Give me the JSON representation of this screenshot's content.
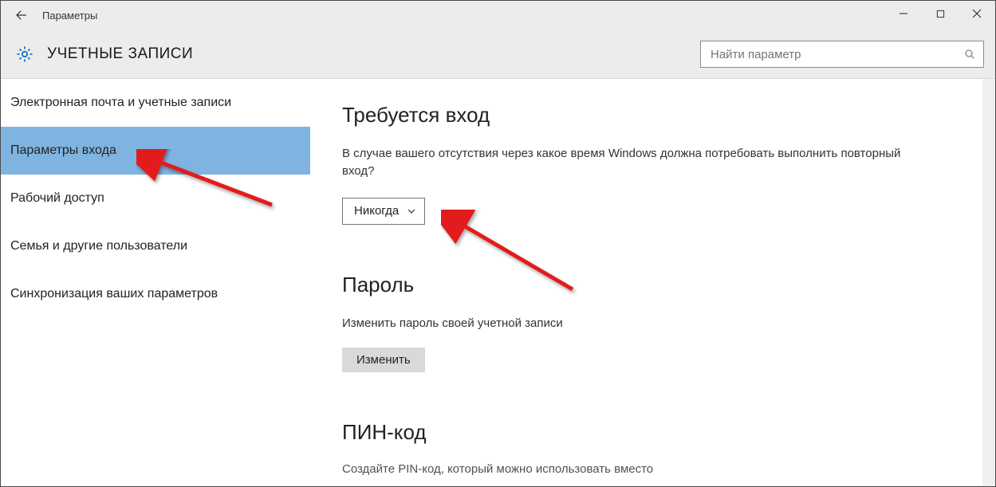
{
  "titlebar": {
    "title": "Параметры"
  },
  "header": {
    "section_title": "УЧЕТНЫЕ ЗАПИСИ"
  },
  "search": {
    "placeholder": "Найти параметр"
  },
  "sidebar": {
    "items": [
      {
        "label": "Электронная почта и учетные записи"
      },
      {
        "label": "Параметры входа"
      },
      {
        "label": "Рабочий доступ"
      },
      {
        "label": "Семья и другие пользователи"
      },
      {
        "label": "Синхронизация ваших параметров"
      }
    ]
  },
  "content": {
    "signin_required": {
      "heading": "Требуется вход",
      "description": "В случае вашего отсутствия через какое время Windows должна потребовать выполнить повторный вход?",
      "dropdown_value": "Никогда"
    },
    "password": {
      "heading": "Пароль",
      "description": "Изменить пароль своей учетной записи",
      "button": "Изменить"
    },
    "pin": {
      "heading": "ПИН-код",
      "truncated": "Создайте PIN-код, который можно использовать вместо"
    }
  }
}
